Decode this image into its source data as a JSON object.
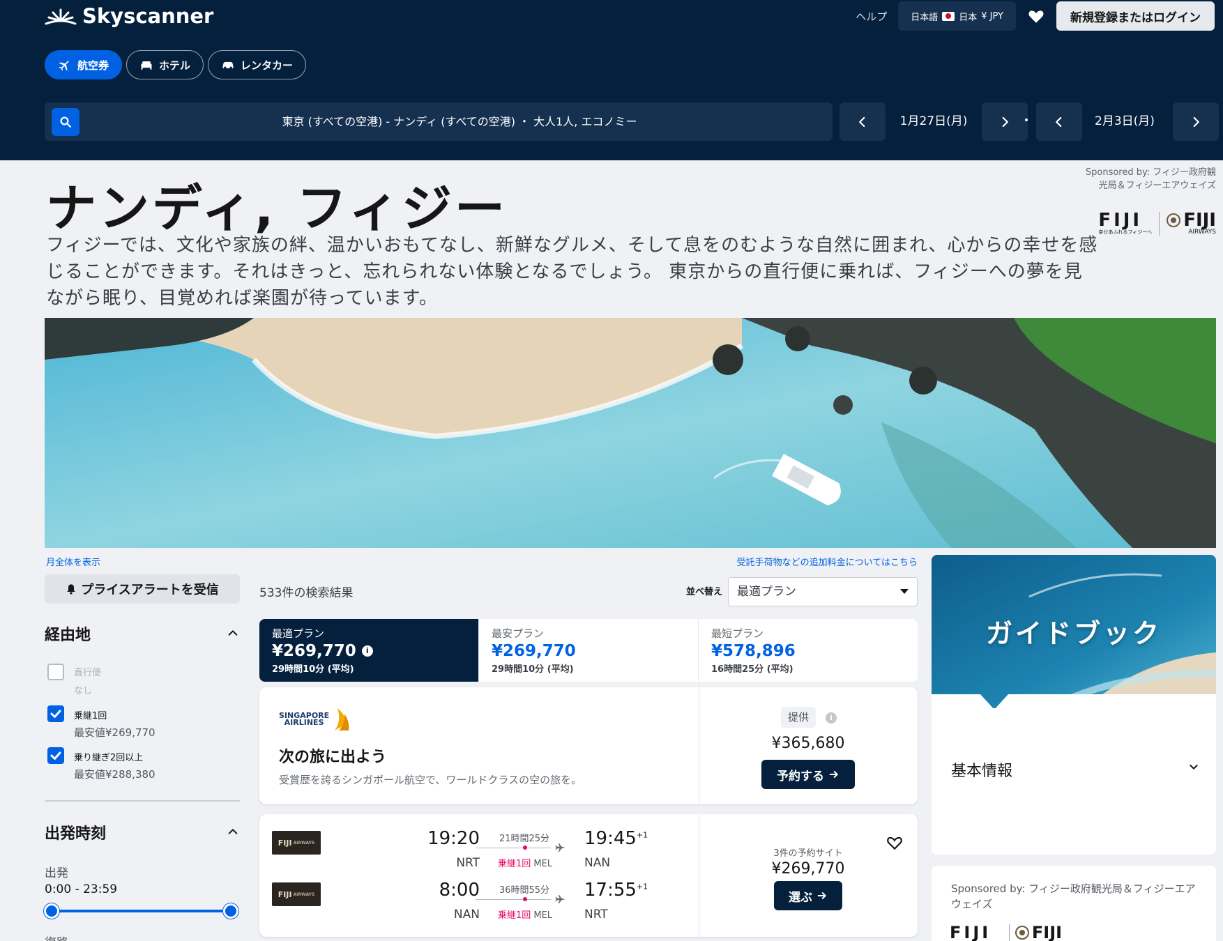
{
  "header": {
    "logo_text": "Skyscanner",
    "help": "ヘルプ",
    "locale": {
      "language": "日本語",
      "country": "日本",
      "currency": "¥ JPY"
    },
    "login": "新規登録またはログイン",
    "tabs": [
      "航空券",
      "ホテル",
      "レンタカー"
    ],
    "search_summary": "東京 (すべての空港) - ナンディ (すべての空港) ・ 大人1人, エコノミー",
    "depart_date": "1月27日(月)",
    "return_date": "2月3日(月)"
  },
  "hero": {
    "sponsor_text": "Sponsored by: フィジー政府観光局＆フィジーエアウェイズ",
    "fiji_logo_word": "FIJI",
    "fiji_logo_sub": "幸せあふれるフィジーへ",
    "fiji_airways_word": "FIJI",
    "fiji_airways_sub": "AIRWAYS",
    "title": "ナンディ, フィジー",
    "description": "フィジーでは、文化や家族の絆、温かいおもてなし、新鮮なグルメ、そして息をのむような自然に囲まれ、心からの幸せを感じることができます。それはきっと、忘れられない体験となるでしょう。 東京からの直行便に乗れば、フィジーへの夢を見ながら眠り、目覚めれば楽園が待っています。"
  },
  "filters": {
    "month_link": "月全体を表示",
    "price_alert": "プライスアラートを受信",
    "stops_title": "経由地",
    "stops": [
      {
        "label": "直行便",
        "sub": "なし",
        "checked": false
      },
      {
        "label": "乗継1回",
        "sub": "最安値¥269,770",
        "checked": true
      },
      {
        "label": "乗り継ぎ2回以上",
        "sub": "最安値¥288,380",
        "checked": true
      }
    ],
    "depart_title": "出発時刻",
    "depart_label": "出発",
    "depart_range": "0:00 - 23:59",
    "return_label": "復路"
  },
  "results": {
    "count": "533件の検索結果",
    "baggage_link": "受託手荷物などの追加料金についてはこちら",
    "sort_label": "並べ替え",
    "sort_value": "最適プラン",
    "sort_tabs": [
      {
        "label": "最適プラン",
        "price": "¥269,770",
        "duration": "29時間10分 (平均)"
      },
      {
        "label": "最安プラン",
        "price": "¥269,770",
        "duration": "29時間10分 (平均)"
      },
      {
        "label": "最短プラン",
        "price": "¥578,896",
        "duration": "16時間25分 (平均)"
      }
    ],
    "ad": {
      "airline_line1": "SINGAPORE",
      "airline_line2": "AIRLINES",
      "title": "次の旅に出よう",
      "description": "受賞歴を誇るシンガポール航空で、ワールドクラスの空の旅を。",
      "badge": "提供",
      "price": "¥365,680",
      "button": "予約する"
    },
    "itinerary": {
      "airline_logo": "FIJI",
      "airline_logo_sub": "AIRWAYS",
      "legs": [
        {
          "dep_time": "19:20",
          "dep_apt": "NRT",
          "duration": "21時間25分",
          "stops": "乗継1回",
          "via": "MEL",
          "arr_time": "19:45",
          "arr_plus": "+1",
          "arr_apt": "NAN"
        },
        {
          "dep_time": "8:00",
          "dep_apt": "NAN",
          "duration": "36時間55分",
          "stops": "乗継1回",
          "via": "MEL",
          "arr_time": "17:55",
          "arr_plus": "+1",
          "arr_apt": "NRT"
        }
      ],
      "deals": "3件の予約サイト",
      "price": "¥269,770",
      "button": "選ぶ"
    }
  },
  "guide": {
    "title": "ガイドブック",
    "section": "基本情報",
    "sponsor": "Sponsored by: フィジー政府観光局＆フィジーエアウェイズ"
  },
  "colors": {
    "navy": "#05203c",
    "blue": "#0062e3",
    "pink": "#e70866"
  }
}
